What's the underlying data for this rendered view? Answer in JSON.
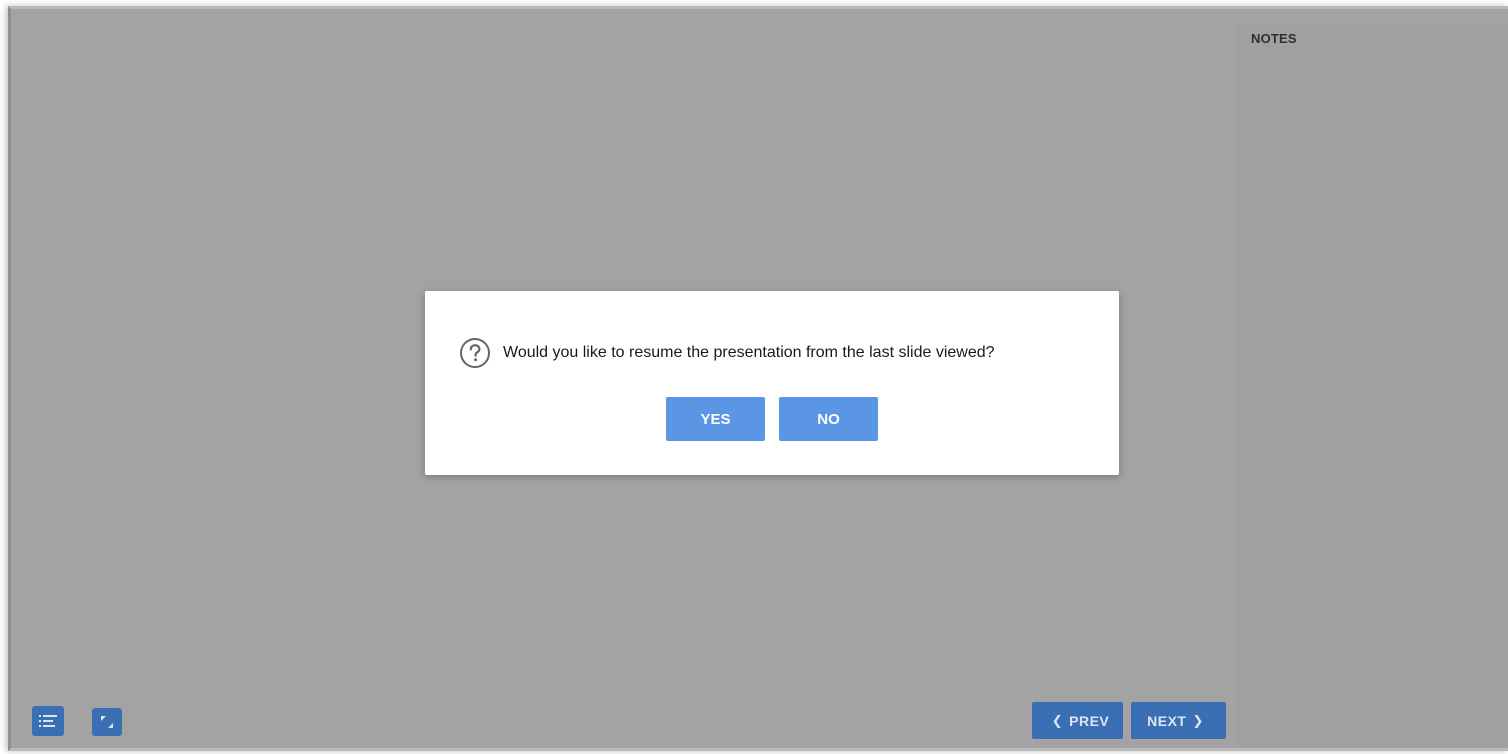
{
  "notes": {
    "title": "NOTES"
  },
  "dialog": {
    "icon": "help-circle-icon",
    "message": "Would you like to resume the presentation from the last slide viewed?",
    "yes_label": "YES",
    "no_label": "NO"
  },
  "toolbar": {
    "toc_icon": "list-menu-icon",
    "fullscreen_icon": "expand-icon"
  },
  "navigation": {
    "prev_label": "PREV",
    "next_label": "NEXT",
    "prev_icon": "chevron-left-icon",
    "next_icon": "chevron-right-icon"
  },
  "colors": {
    "accent": "#5b96e4",
    "nav_button": "#3b6fb3",
    "overlay": "#a3a3a3"
  }
}
